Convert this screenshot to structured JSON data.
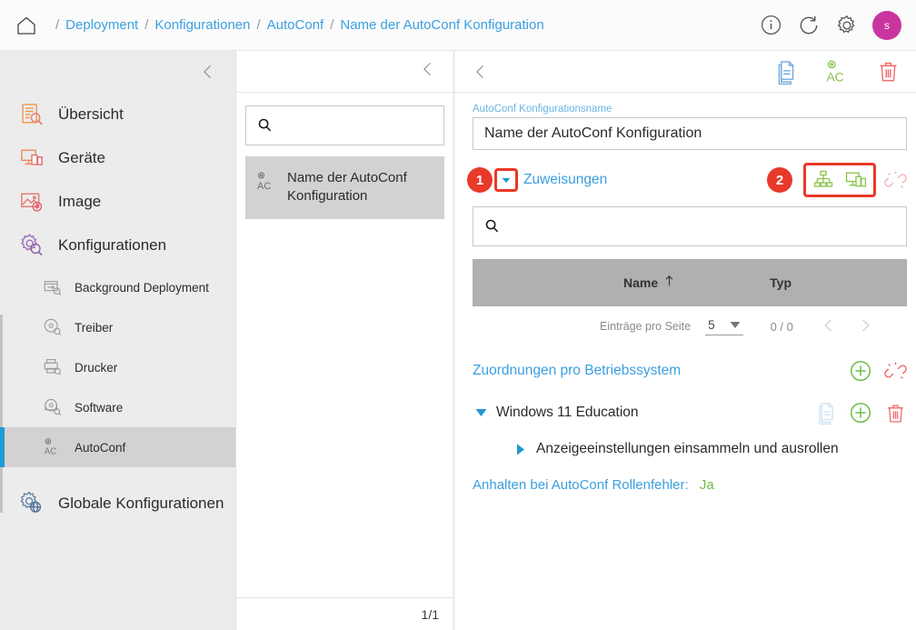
{
  "topbar": {
    "home_icon": "home-icon",
    "breadcrumbs": [
      {
        "label": "Deployment"
      },
      {
        "label": "Konfigurationen"
      },
      {
        "label": "AutoConf"
      },
      {
        "label": "Name der AutoConf Konfiguration"
      }
    ],
    "separator": "/",
    "actions": [
      {
        "name": "info-icon",
        "label": "i"
      },
      {
        "name": "refresh-icon",
        "label": ""
      },
      {
        "name": "gear-icon",
        "label": ""
      }
    ],
    "avatar_initial": "s",
    "avatar_color": "#c9359f"
  },
  "sidebar": {
    "collapse_icon": "chevron-left-icon",
    "items": [
      {
        "label": "Übersicht",
        "icon": "overview-icon"
      },
      {
        "label": "Geräte",
        "icon": "devices-icon"
      },
      {
        "label": "Image",
        "icon": "image-icon"
      },
      {
        "label": "Konfigurationen",
        "icon": "gear-config-icon"
      }
    ],
    "sub_items": [
      {
        "label": "Background Deployment",
        "icon": "background-deployment-icon",
        "active": false
      },
      {
        "label": "Treiber",
        "icon": "driver-icon",
        "active": false
      },
      {
        "label": "Drucker",
        "icon": "printer-icon",
        "active": false
      },
      {
        "label": "Software",
        "icon": "software-icon",
        "active": false
      },
      {
        "label": "AutoConf",
        "icon": "autoconf-icon",
        "active": true
      }
    ],
    "footer_item": {
      "label": "Globale Konfigurationen",
      "icon": "globe-gear-icon"
    },
    "accent_color": "#1e9ad6"
  },
  "list_panel": {
    "collapse_icon": "chevron-left-icon",
    "search_placeholder": "",
    "search_value": "",
    "items": [
      {
        "label": "Name der AutoConf Konfiguration",
        "icon": "autoconf-icon",
        "selected": true
      }
    ],
    "footer_count": "1/1"
  },
  "main": {
    "back_icon": "chevron-left-icon",
    "header_actions": [
      {
        "name": "copy-icon",
        "color": "#7ab8e8"
      },
      {
        "name": "autoconf-ac-icon",
        "color": "#8bc34a"
      },
      {
        "name": "delete-icon",
        "color": "#ef6b6b"
      }
    ],
    "name_field": {
      "label": "AutoConf Konfigurationsname",
      "value": "Name der AutoConf Konfiguration"
    },
    "assignments": {
      "badge_1": "1",
      "badge_2": "2",
      "toggle_icon": "caret-down-icon",
      "title": "Zuweisungen",
      "icons": [
        {
          "name": "org-tree-icon",
          "color": "#8bc34a",
          "highlighted": true
        },
        {
          "name": "devices-assign-icon",
          "color": "#8bc34a",
          "highlighted": true
        },
        {
          "name": "broken-link-icon",
          "color": "#f3b5b5",
          "highlighted": false
        }
      ],
      "search_placeholder": "",
      "search_value": "",
      "table": {
        "columns": [
          "Name",
          "Typ"
        ],
        "sort_column": "Name",
        "sort_direction": "asc",
        "sort_icon": "arrow-up-icon",
        "rows": []
      },
      "pager": {
        "label": "Einträge pro Seite",
        "page_size": "5",
        "dropdown_icon": "caret-down-icon",
        "count": "0 / 0",
        "prev_icon": "chevron-left-icon",
        "next_icon": "chevron-right-icon"
      }
    },
    "os_assignments": {
      "title": "Zuordnungen pro Betriebssystem",
      "icons": [
        {
          "name": "add-icon",
          "color": "#6cbf4b"
        },
        {
          "name": "broken-link-icon",
          "color": "#ef6b6b"
        }
      ],
      "os_node": {
        "caret_icon": "caret-down-icon",
        "label": "Windows 11 Education",
        "icons": [
          {
            "name": "copy-icon",
            "color": "#cfe4f5"
          },
          {
            "name": "add-icon",
            "color": "#6cbf4b"
          },
          {
            "name": "delete-icon",
            "color": "#ef6b6b"
          }
        ]
      },
      "child_node": {
        "caret_icon": "caret-right-icon",
        "label": "Anzeigeeinstellungen einsammeln und ausrollen"
      }
    },
    "footer_note": {
      "key": "Anhalten bei AutoConf Rollenfehler:",
      "value": "Ja"
    }
  }
}
